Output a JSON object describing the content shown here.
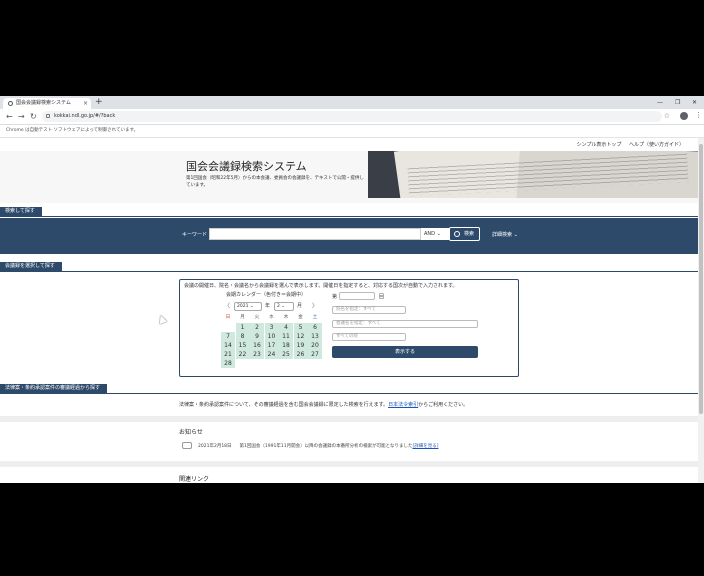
{
  "browser": {
    "tab_title": "国会会議録検索システム",
    "tab_close": "×",
    "new_tab": "+",
    "window_controls": [
      "—",
      "❐",
      "✕"
    ],
    "nav": {
      "back": "←",
      "forward": "→",
      "reload": "↻"
    },
    "url": "kokkai.ndl.go.jp/#/?back",
    "infobar": "Chrome は自動テスト ソフトウェアによって制御されています。",
    "more": "⋮",
    "star": "☆"
  },
  "header": {
    "links": [
      "シンプル表示トップ",
      "ヘルプ（使い方ガイド）"
    ],
    "site_title": "国会会議録検索システム",
    "site_desc": "第1回国会（昭和22年5月）からの本会議、委員会の会議録を、テキストで公開・提供しています。"
  },
  "search": {
    "section_label": "検索して探す",
    "keyword_label": "キーワード",
    "keyword_value": "",
    "operator": "AND",
    "button_label": "検索",
    "advanced_label": "詳細検索"
  },
  "meeting": {
    "section_label": "会議録を選択して探す",
    "note": "会議の開催日、院名・会議名から会議録を選んで表示します。開催日を指定すると、対応する国次が自動で入力されます。",
    "calendar_title": "会期カレンダー（色付き＝会期中）",
    "year_value": "2021",
    "year_unit": "年",
    "month_value": "2",
    "month_unit": "月",
    "prev": "〈",
    "next": "〉",
    "weekdays": [
      "日",
      "月",
      "火",
      "水",
      "木",
      "金",
      "土"
    ],
    "days": [
      "1",
      "2",
      "3",
      "4",
      "5",
      "6",
      "7",
      "8",
      "9",
      "10",
      "11",
      "12",
      "13",
      "14",
      "15",
      "16",
      "17",
      "18",
      "19",
      "20",
      "21",
      "22",
      "23",
      "24",
      "25",
      "26",
      "27",
      "28"
    ],
    "first_weekday": 1,
    "session_label_prefix": "第",
    "session_label_suffix": "回",
    "session_value": "",
    "house_placeholder": "院名を指定：すべて",
    "meeting_placeholder": "会議名を指定：すべて",
    "all_placeholder": "すべての院",
    "show_button": "表示する"
  },
  "law": {
    "section_label": "法律案・条約承認案件の審議経過から探す",
    "text_before": "法律案・条約承認案件について、その審議経過を含む国会会議録に限定した検索を行えます。",
    "link": "日本法令索引",
    "text_after": "からご利用ください。"
  },
  "notices": {
    "title": "お知らせ",
    "items": [
      {
        "date": "2021年2月18日",
        "text": "第1回国会（1991年11月開会）以降の会議録の本番所分析の検索が可能となりました",
        "link": "[詳細を見る]"
      }
    ]
  },
  "related": {
    "title": "関連リンク"
  }
}
